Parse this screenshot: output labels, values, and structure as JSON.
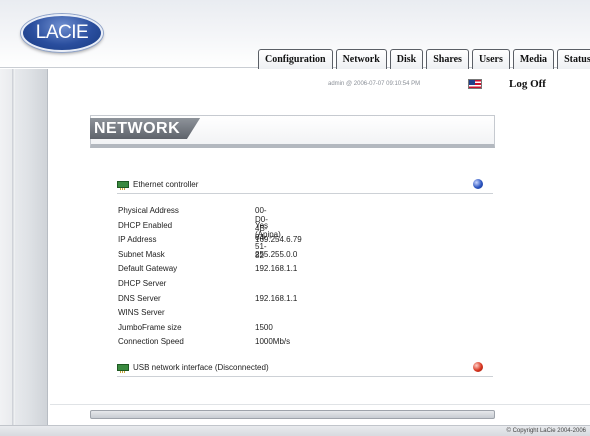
{
  "brand": {
    "logo_text": "LACIE"
  },
  "tabs": [
    {
      "label": "Configuration"
    },
    {
      "label": "Network"
    },
    {
      "label": "Disk"
    },
    {
      "label": "Shares"
    },
    {
      "label": "Users"
    },
    {
      "label": "Media"
    },
    {
      "label": "Status"
    }
  ],
  "session": {
    "text": "admin @ 2006-07-07 09:10:54 PM",
    "logoff_label": "Log Off"
  },
  "section": {
    "title": "NETWORK"
  },
  "ethernet": {
    "label": "Ethernet controller",
    "status_color": "#2c55c0",
    "properties": [
      {
        "key": "Physical Address",
        "value": "00-D0-4B-04-51-82"
      },
      {
        "key": "DHCP Enabled",
        "value": "Yes (Apipa)"
      },
      {
        "key": "IP Address",
        "value": "169.254.6.79"
      },
      {
        "key": "Subnet Mask",
        "value": "255.255.0.0"
      },
      {
        "key": "Default Gateway",
        "value": "192.168.1.1"
      },
      {
        "key": "DHCP Server",
        "value": ""
      },
      {
        "key": "DNS Server",
        "value": "192.168.1.1"
      },
      {
        "key": "WINS Server",
        "value": ""
      },
      {
        "key": "JumboFrame size",
        "value": "1500"
      },
      {
        "key": "Connection Speed",
        "value": "1000Mb/s"
      }
    ]
  },
  "usb": {
    "label": "USB network interface (Disconnected)",
    "status_color": "#d8351f"
  },
  "footer": {
    "copyright": "© Copyright LaCie 2004-2006"
  }
}
